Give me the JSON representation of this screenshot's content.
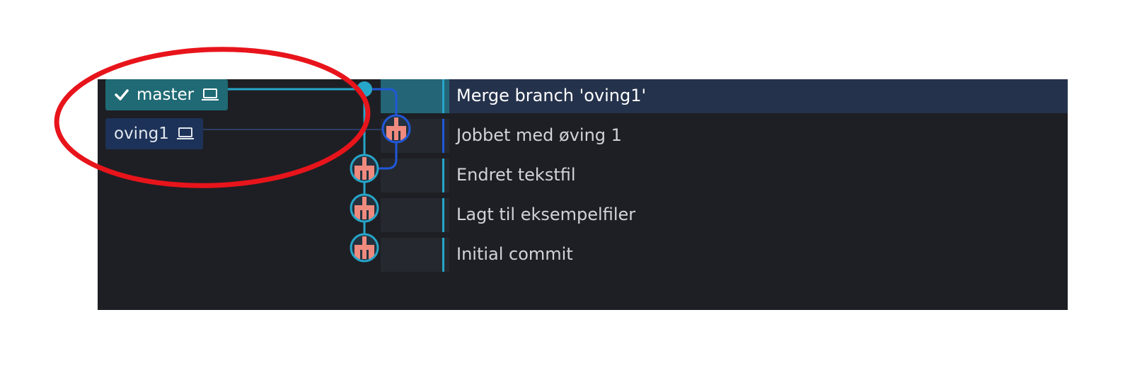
{
  "refs": {
    "master": {
      "label": "master",
      "checked_out": true
    },
    "oving1": {
      "label": "oving1",
      "checked_out": false
    }
  },
  "commits": [
    {
      "message": "Merge branch 'oving1'",
      "branch": "master",
      "selected": true,
      "merge": true
    },
    {
      "message": "Jobbet med øving 1",
      "branch": "oving1",
      "selected": false
    },
    {
      "message": "Endret tekstfil",
      "branch": "master",
      "selected": false
    },
    {
      "message": "Lagt til eksempelfiler",
      "branch": "master",
      "selected": false
    },
    {
      "message": "Initial commit",
      "branch": "master",
      "selected": false
    }
  ],
  "colors": {
    "panel_bg": "#1e1f24",
    "master_lane": "#26a6c9",
    "oving_lane": "#2058d8",
    "avatar": "#ef8a7e",
    "annotation": "#e8141b"
  },
  "icons": {
    "check": "check-icon",
    "laptop": "laptop-icon",
    "avatar": "identicon-avatar"
  }
}
